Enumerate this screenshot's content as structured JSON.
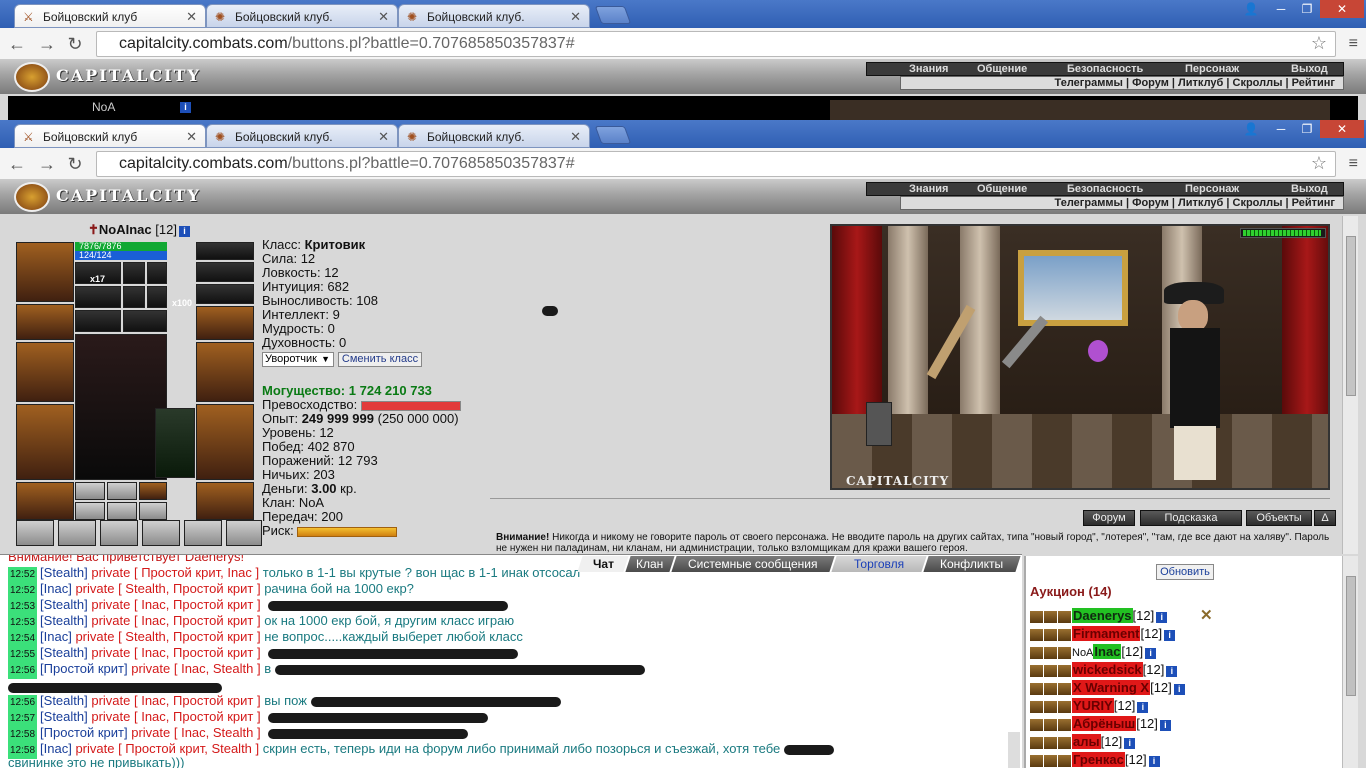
{
  "browser": {
    "tabs": [
      {
        "title": "Бойцовский клуб"
      },
      {
        "title": "Бойцовский клуб."
      },
      {
        "title": "Бойцовский клуб."
      }
    ],
    "url_host": "capitalcity.combats.com",
    "url_path": "/buttons.pl?battle=0.707685850357837#"
  },
  "site": {
    "logo_text": "CAPITALCITY",
    "main_menu": [
      "Знания",
      "Общение",
      "Безопасность",
      "Персонаж",
      "Выход"
    ],
    "sub_menu": "Телеграммы | Форум | Литклуб | Скроллы | Рейтинг",
    "background_header_text": "NoA"
  },
  "character": {
    "name": "NoAInac",
    "level": "[12]",
    "hp": "7876/7876",
    "mp": "124/124",
    "slot_counts": [
      "x17",
      "x100"
    ],
    "stats": [
      {
        "label": "Класс:",
        "value": "Критовик"
      },
      {
        "label": "Сила:",
        "value": "12"
      },
      {
        "label": "Ловкость:",
        "value": "12"
      },
      {
        "label": "Интуиция:",
        "value": "682"
      },
      {
        "label": "Выносливость:",
        "value": "108"
      },
      {
        "label": "Интеллект:",
        "value": "9"
      },
      {
        "label": "Мудрость:",
        "value": "0"
      },
      {
        "label": "Духовность:",
        "value": "0"
      }
    ],
    "class_select": "Уворотчик",
    "change_class_button": "Сменить класс",
    "power_label": "Могущество:",
    "power_value": "1 724 210 733",
    "superiority_label": "Превосходство:",
    "exp_label": "Опыт:",
    "exp_value": "249 999 999",
    "exp_next": "(250 000 000)",
    "level_label": "Уровень:",
    "level_value": "12",
    "wins_label": "Побед:",
    "wins_value": "402 870",
    "losses_label": "Поражений:",
    "losses_value": "12 793",
    "draws_label": "Ничьих:",
    "draws_value": "203",
    "money_label": "Деньги:",
    "money_value": "3.00",
    "money_unit": "кр.",
    "clan_label": "Клан:",
    "clan_value": "NoA",
    "transfers_label": "Передач:",
    "transfers_value": "200",
    "risk_label": "Риск:",
    "scene_caption": "CAPITALCITY",
    "warning_bold": "Внимание!",
    "warning_text": "Никогда и никому не говорите пароль от своего персонажа. Не вводите пароль на других сайтах, типа \"новый город\", \"лотерея\", \"там, где все дают на халяву\". Пароль не нужен ни паладинам, ни кланам, ни администрации, только взломщикам для кражи вашего героя."
  },
  "bottom_buttons": [
    "Форум",
    "Подсказка",
    "Объекты",
    "Δ"
  ],
  "chat": {
    "tabs": [
      "Чат",
      "Клан",
      "Системные сообщения",
      "Торговля",
      "Конфликты"
    ],
    "first_line": "Внимание! Вас приветствует Daenerys!",
    "lines": [
      {
        "ts": "12:52",
        "nick": "[Stealth]",
        "priv": "private [ Простой крит, Inac ]",
        "msg": "только в 1-1 вы крутые ? вон щас в 1-1 инак отсосал"
      },
      {
        "ts": "12:52",
        "nick": "[Inac]",
        "priv": "private [ Stealth, Простой крит ]",
        "msg": "рачина бой на 1000 екр?"
      },
      {
        "ts": "12:53",
        "nick": "[Stealth]",
        "priv": "private [ Inac, Простой крит ]",
        "msg": ""
      },
      {
        "ts": "12:53",
        "nick": "[Stealth]",
        "priv": "private [ Inac, Простой крит ]",
        "msg": "ок на 1000 екр бой, я другим класс играю"
      },
      {
        "ts": "12:54",
        "nick": "[Inac]",
        "priv": "private [ Stealth, Простой крит ]",
        "msg": "не вопрос.....каждый выберет любой класс"
      },
      {
        "ts": "12:55",
        "nick": "[Stealth]",
        "priv": "private [ Inac, Простой крит ]",
        "msg": ""
      },
      {
        "ts": "12:56",
        "nick": "[Простой крит]",
        "priv": "private [ Inac, Stealth ]",
        "msg": "в"
      },
      {
        "ts": "12:56",
        "nick": "[Stealth]",
        "priv": "private [ Inac, Простой крит ]",
        "msg": "вы пож"
      },
      {
        "ts": "12:57",
        "nick": "[Stealth]",
        "priv": "private [ Inac, Простой крит ]",
        "msg": ""
      },
      {
        "ts": "12:58",
        "nick": "[Простой крит]",
        "priv": "private [ Inac, Stealth ]",
        "msg": ""
      },
      {
        "ts": "12:58",
        "nick": "[Inac]",
        "priv": "private [ Простой крит, Stealth ]",
        "msg": "скрин есть, теперь иди на форум либо принимай либо позорься и съезжай, хотя тебе"
      }
    ],
    "last_line": "свининке это не привыкать)))"
  },
  "auction": {
    "refresh_button": "Обновить",
    "title": "Аукцион (14)",
    "users": [
      {
        "name": "Daenerys",
        "level": "[12]",
        "style": "g"
      },
      {
        "name": "Firmament",
        "level": "[12]",
        "style": "r"
      },
      {
        "prefix": "NoA",
        "name": "Inac",
        "level": "[12]",
        "style": "g"
      },
      {
        "name": "wickedsick",
        "level": "[12]",
        "style": "r"
      },
      {
        "name": "X Warning X",
        "level": "[12]",
        "style": "r"
      },
      {
        "name": "YURIY",
        "level": "[12]",
        "style": "r"
      },
      {
        "name": "Абрёныш",
        "level": "[12]",
        "style": "r"
      },
      {
        "name": "алы",
        "level": "[12]",
        "style": "r"
      },
      {
        "name": "Гренкас",
        "level": "[12]",
        "style": "r"
      }
    ]
  }
}
